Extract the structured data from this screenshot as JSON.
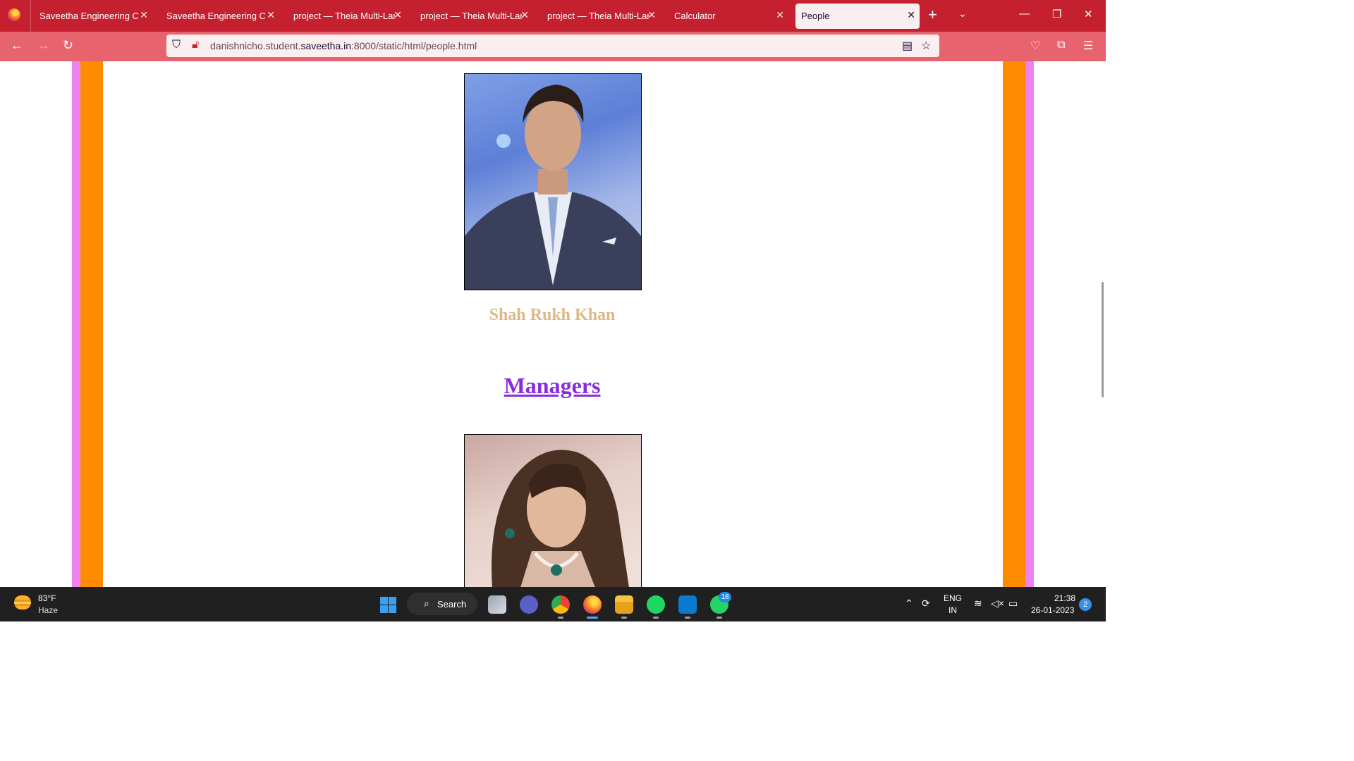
{
  "browser": {
    "tabs": [
      {
        "label": "Saveetha Engineering Colle"
      },
      {
        "label": "Saveetha Engineering Colle"
      },
      {
        "label": "project — Theia Multi-Lang"
      },
      {
        "label": "project — Theia Multi-Lang"
      },
      {
        "label": "project — Theia Multi-Lang"
      },
      {
        "label": "Calculator"
      },
      {
        "label": "People",
        "active": true
      }
    ],
    "new_tab": "+",
    "tab_list": "⌄",
    "close_glyph": "✕",
    "url_domain_pre": "danishnicho.student.",
    "url_domain_main": "saveetha.in",
    "url_path": ":8000/static/html/people.html"
  },
  "page": {
    "person_name": "Shah Rukh Khan",
    "section_heading": "Managers",
    "colors": {
      "border_pink": "#ee82ee",
      "border_orange": "#ff8c00",
      "name": "#deb887",
      "heading": "#8a2be2"
    }
  },
  "taskbar": {
    "temperature": "83°F",
    "condition": "Haze",
    "search_label": "Search",
    "whatsapp_badge": "18",
    "lang_line1": "ENG",
    "lang_line2": "IN",
    "time": "21:38",
    "date": "26-01-2023",
    "notifications": "2"
  }
}
